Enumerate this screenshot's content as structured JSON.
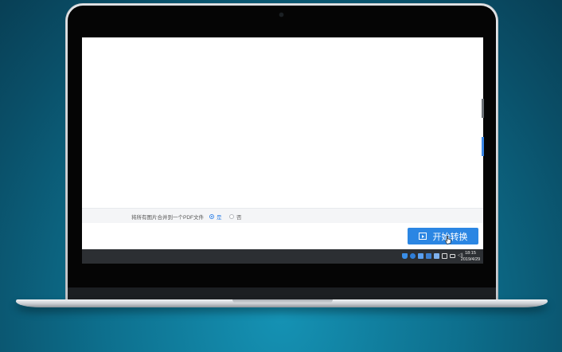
{
  "options": {
    "merge_label": "将所有图片合并到一个PDF文件",
    "yes_label": "是",
    "no_label": "否",
    "selected": "是"
  },
  "actions": {
    "start_button_label": "开始转换"
  },
  "taskbar": {
    "time": "18:15",
    "date": "2019/4/29"
  },
  "colors": {
    "accent": "#2b86e3",
    "taskbar": "#2c2f33",
    "background": "#0d6f8d"
  },
  "icons": {
    "start": "play-icon",
    "cursor": "hand-pointer-icon"
  }
}
